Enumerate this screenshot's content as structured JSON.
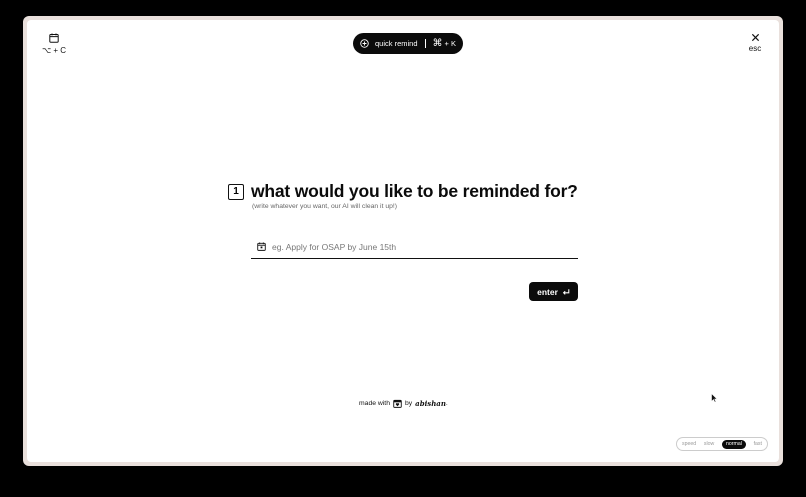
{
  "top_left": {
    "keys": "⌥ + C",
    "icon": "calendar-icon"
  },
  "pill": {
    "label": "quick remind",
    "shortcut_cmd": "⌘",
    "shortcut_rest": "+ K",
    "icon": "plus-circle-icon"
  },
  "close": {
    "label": "esc",
    "icon": "close-icon"
  },
  "question": {
    "step": "1",
    "title": "what would you like to be reminded for?",
    "subtitle": "(write whatever you want, our AI will clean it up!)"
  },
  "input": {
    "placeholder": "eg. Apply for OSAP by June 15th",
    "value": ""
  },
  "enter_button": {
    "label": "enter"
  },
  "footer": {
    "made_with": "made with",
    "by": "by",
    "author": "abishan",
    "trailing": "."
  },
  "speed_selector": {
    "options": [
      "speed",
      "slow",
      "normal",
      "fast"
    ],
    "selected": "normal"
  },
  "colors": {
    "accent": "#0b0b0b",
    "background": "#ffffff",
    "frame": "#e9e0dc"
  }
}
